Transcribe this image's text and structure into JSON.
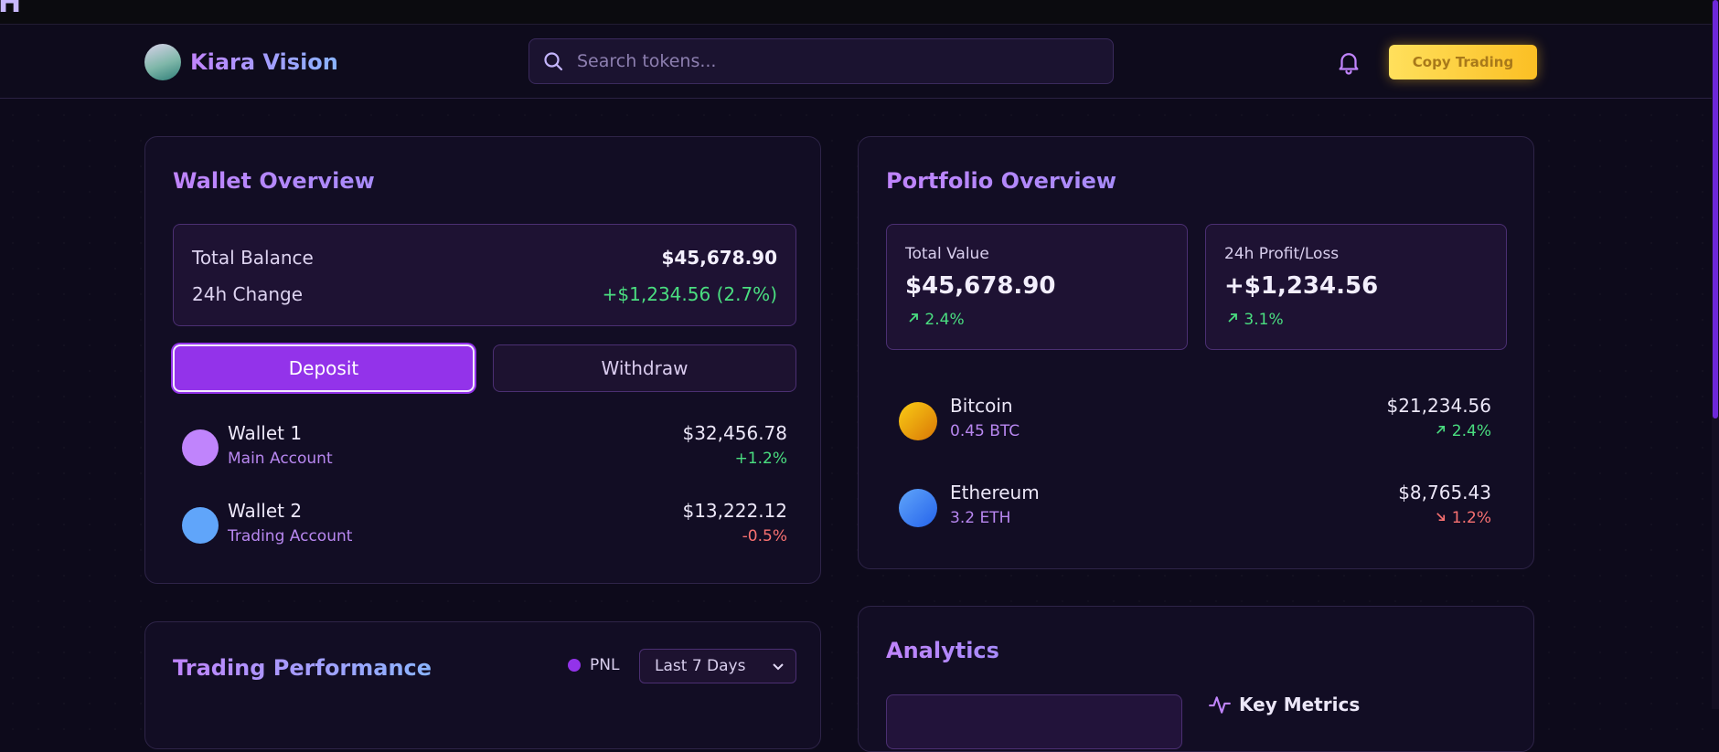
{
  "top_fragment": "H",
  "brand": {
    "name": "Kiara Vision"
  },
  "search": {
    "placeholder": "Search tokens..."
  },
  "header": {
    "copy_trading_label": "Copy Trading"
  },
  "wallet_overview": {
    "title": "Wallet Overview",
    "total_balance_label": "Total Balance",
    "total_balance_value": "$45,678.90",
    "change_label": "24h Change",
    "change_value": "+$1,234.56 (2.7%)",
    "deposit_label": "Deposit",
    "withdraw_label": "Withdraw",
    "wallets": [
      {
        "name": "Wallet 1",
        "type": "Main Account",
        "amount": "$32,456.78",
        "change": "+1.2%",
        "color": "#c084fc",
        "trend": "up"
      },
      {
        "name": "Wallet 2",
        "type": "Trading Account",
        "amount": "$13,222.12",
        "change": "-0.5%",
        "color": "#60a5fa",
        "trend": "down"
      }
    ]
  },
  "portfolio_overview": {
    "title": "Portfolio Overview",
    "total_value_label": "Total Value",
    "total_value": "$45,678.90",
    "total_value_pct": "2.4%",
    "pnl_label": "24h Profit/Loss",
    "pnl_value": "+$1,234.56",
    "pnl_pct": "3.1%",
    "tokens": [
      {
        "name": "Bitcoin",
        "amount": "0.45 BTC",
        "value": "$21,234.56",
        "change": "2.4%",
        "trend": "up",
        "icon": "bitcoin-icon"
      },
      {
        "name": "Ethereum",
        "amount": "3.2 ETH",
        "value": "$8,765.43",
        "change": "1.2%",
        "trend": "down",
        "icon": "ethereum-icon"
      }
    ]
  },
  "trading_performance": {
    "title": "Trading Performance",
    "legend_label": "PNL",
    "range_label": "Last 7 Days"
  },
  "analytics": {
    "title": "Analytics",
    "key_metrics_label": "Key Metrics"
  },
  "colors": {
    "accent": "#9333ea",
    "positive": "#4ade80",
    "negative": "#f87171",
    "cta": "#fbbf24"
  }
}
